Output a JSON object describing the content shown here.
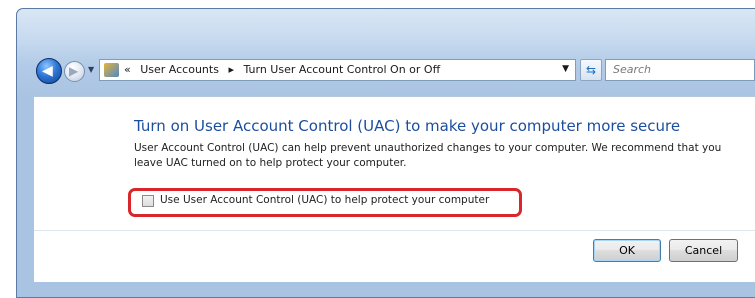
{
  "nav": {
    "breadcrumb": [
      "«",
      "User Accounts",
      "▸",
      "Turn User Account Control On or Off"
    ],
    "search_placeholder": "Search"
  },
  "main": {
    "heading": "Turn on User Account Control (UAC) to make your computer more secure",
    "description": "User Account Control (UAC) can help prevent unauthorized changes to your computer.  We recommend that you leave UAC turned on to help protect your computer.",
    "checkbox_label": "Use User Account Control (UAC) to help protect your computer",
    "checkbox_checked": false
  },
  "buttons": {
    "ok": "OK",
    "cancel": "Cancel"
  },
  "colors": {
    "heading": "#1c4e9e",
    "highlight": "#d9262b",
    "frame": "#b0c9e6"
  },
  "icons": [
    "back-arrow-icon",
    "forward-arrow-icon",
    "recent-pages-icon",
    "control-panel-icon",
    "address-dropdown-icon",
    "refresh-icon"
  ]
}
